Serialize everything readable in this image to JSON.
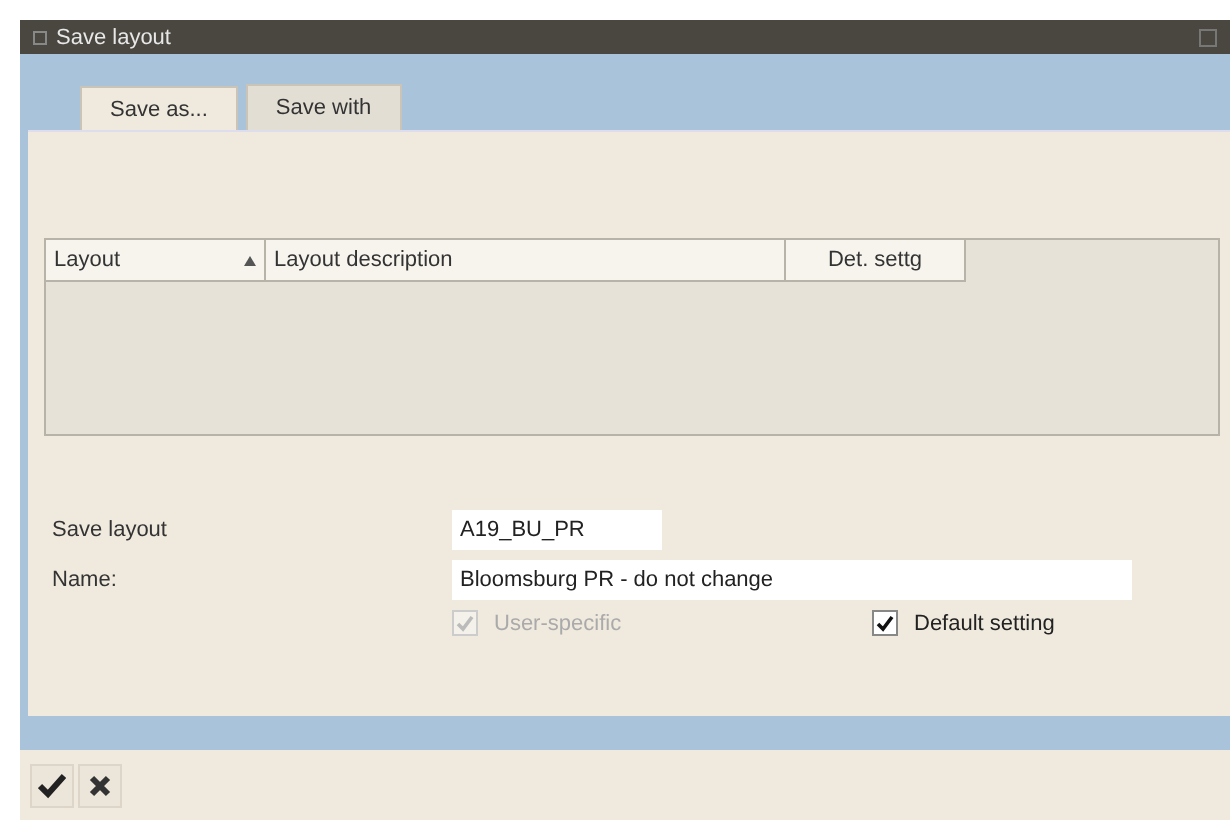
{
  "window": {
    "title": "Save layout"
  },
  "tabs": [
    {
      "label": "Save as...",
      "selected": true
    },
    {
      "label": "Save with",
      "selected": false
    }
  ],
  "table": {
    "columns": [
      {
        "label": "Layout",
        "sorted": true
      },
      {
        "label": "Layout description",
        "sorted": false
      },
      {
        "label": "Det. settg",
        "sorted": false
      }
    ]
  },
  "form": {
    "fields": [
      {
        "label": "Save layout",
        "value": "A19_BU_PR",
        "wide": false
      },
      {
        "label": "Name:",
        "value": "Bloomsburg PR - do not change",
        "wide": true
      }
    ],
    "checkboxes": [
      {
        "label": "User-specific",
        "checked": true,
        "disabled": true
      },
      {
        "label": "Default setting",
        "checked": true,
        "disabled": false
      }
    ]
  },
  "toolbar": [
    {
      "kind": "confirm"
    },
    {
      "kind": "cancel"
    }
  ]
}
